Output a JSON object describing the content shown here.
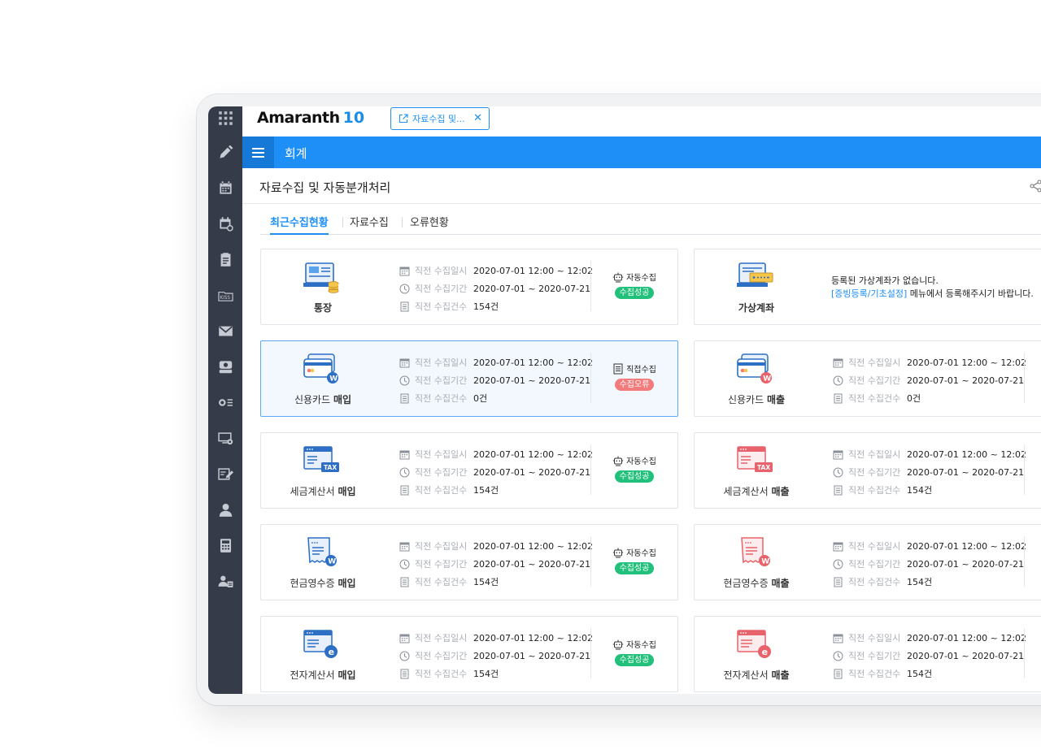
{
  "app": {
    "logo_text": "Amaranth",
    "logo_number": "10",
    "open_tab_label": "자료수집 및...",
    "module": "회계",
    "page_title": "자료수집 및 자동분개처리"
  },
  "tabs": [
    "최근수집현황",
    "자료수집",
    "오류현황"
  ],
  "labels": {
    "date": "직전 수집일시",
    "period": "직전 수집기간",
    "count": "직전 수집건수"
  },
  "cards": [
    {
      "name_pre": "",
      "name_bold": "통장",
      "date": "2020-07-01   12:00 ~ 12:02",
      "period": "2020-07-01 ~ 2020-07-21",
      "count": "154건",
      "type": "자동수집",
      "status": "수집성공"
    },
    {
      "name_pre": "",
      "name_bold": "가상계좌",
      "msg1": "등록된 가상계좌가 없습니다.",
      "msg_link": "[증빙등록/기초설정]",
      "msg2": " 메뉴에서 등록해주시기 바랍니다."
    },
    {
      "name_pre": "신용카드 ",
      "name_bold": "매입",
      "date": "2020-07-01   12:00 ~ 12:02",
      "period": "2020-07-01 ~ 2020-07-21",
      "count": "0건",
      "type": "직접수집",
      "status": "수집오류"
    },
    {
      "name_pre": "신용카드 ",
      "name_bold": "매출",
      "date": "2020-07-01   12:00 ~ 12:02",
      "period": "2020-07-01 ~ 2020-07-21",
      "count": "0건"
    },
    {
      "name_pre": "세금계산서 ",
      "name_bold": "매입",
      "date": "2020-07-01   12:00 ~ 12:02",
      "period": "2020-07-01 ~ 2020-07-21",
      "count": "154건",
      "type": "자동수집",
      "status": "수집성공"
    },
    {
      "name_pre": "세금계산서 ",
      "name_bold": "매출",
      "date": "2020-07-01   12:00 ~ 12:02",
      "period": "2020-07-01 ~ 2020-07-21",
      "count": "154건"
    },
    {
      "name_pre": "현금영수증 ",
      "name_bold": "매입",
      "date": "2020-07-01   12:00 ~ 12:02",
      "period": "2020-07-01 ~ 2020-07-21",
      "count": "154건",
      "type": "자동수집",
      "status": "수집성공"
    },
    {
      "name_pre": "현금영수증 ",
      "name_bold": "매출",
      "date": "2020-07-01   12:00 ~ 12:02",
      "period": "2020-07-01 ~ 2020-07-21",
      "count": "154건"
    },
    {
      "name_pre": "전자계산서 ",
      "name_bold": "매입",
      "date": "2020-07-01   12:00 ~ 12:02",
      "period": "2020-07-01 ~ 2020-07-21",
      "count": "154건",
      "type": "자동수집",
      "status": "수집성공"
    },
    {
      "name_pre": "전자계산서 ",
      "name_bold": "매출",
      "date": "2020-07-01   12:00 ~ 12:02",
      "period": "2020-07-01 ~ 2020-07-21",
      "count": "154건"
    }
  ],
  "sidebar_icons": [
    "apps-grid-icon",
    "pen-icon",
    "calendar-icon",
    "calendar-clock-icon",
    "clipboard-icon",
    "kiss-folder-icon",
    "mail-icon",
    "drive-icon",
    "toggle-list-icon",
    "monitor-settings-icon",
    "edit-doc-icon",
    "person-icon",
    "calculator-icon",
    "person-card-icon"
  ],
  "colors": {
    "primary": "#1e8ff7",
    "sidebar": "#353b48",
    "success": "#22c17b",
    "error": "#f37b7b"
  }
}
